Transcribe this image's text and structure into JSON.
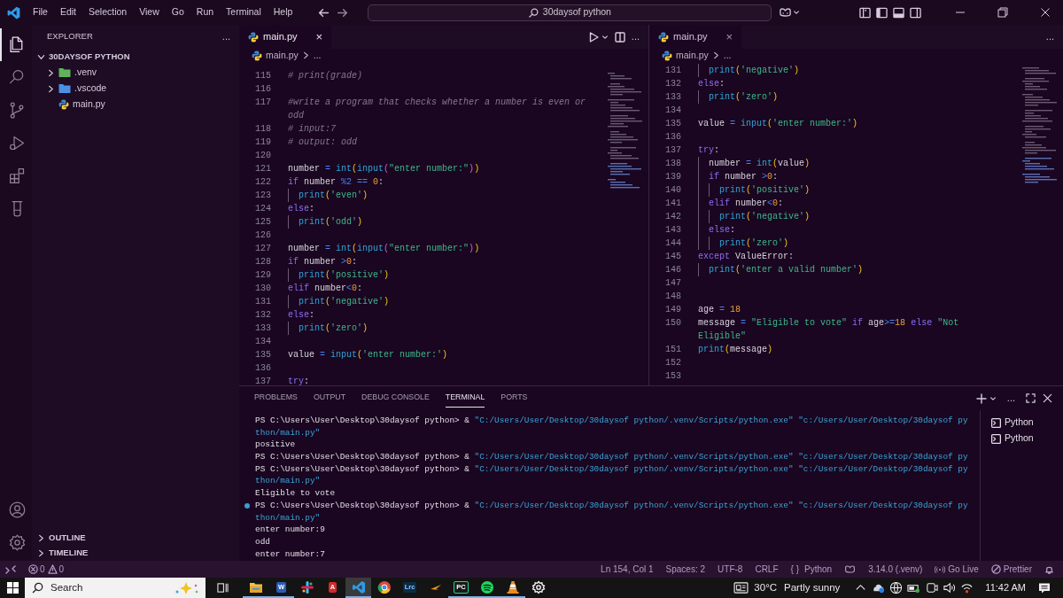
{
  "menu": [
    "File",
    "Edit",
    "Selection",
    "View",
    "Go",
    "Run",
    "Terminal",
    "Help"
  ],
  "command_center": {
    "text": "30daysof python"
  },
  "activity_bar": [
    {
      "selected": true
    },
    {
      "selected": false
    },
    {
      "selected": false
    },
    {
      "selected": false
    },
    {
      "selected": false
    },
    {
      "selected": false
    }
  ],
  "sidebar": {
    "title": "EXPLORER",
    "more": "...",
    "folder": {
      "name": "30DAYSOF PYTHON",
      "expanded": true,
      "children": [
        {
          "name": ".venv",
          "kind": "folder",
          "expanded": false,
          "color": "#5fb35a"
        },
        {
          "name": ".vscode",
          "kind": "folder",
          "expanded": false,
          "color": "#4c90e6"
        },
        {
          "name": "main.py",
          "kind": "file"
        }
      ]
    },
    "sections": [
      {
        "name": "OUTLINE",
        "expanded": false
      },
      {
        "name": "TIMELINE",
        "expanded": false
      }
    ]
  },
  "editors": [
    {
      "tab": {
        "label": "main.py",
        "close": "×",
        "focused": true
      },
      "run_actions": true,
      "more": "...",
      "breadcrumb": [
        "main.py",
        "..."
      ],
      "lines": [
        {
          "number": "115",
          "tokens": [
            {
              "kind": "comment",
              "text": "# print(grade)"
            }
          ]
        },
        {
          "number": "116"
        },
        {
          "number": "117",
          "tokens": [
            {
              "kind": "comment",
              "text": "#write a program that checks whether a number is even or"
            },
            {
              "kind": "break"
            },
            {
              "kind": "comment",
              "text": "odd"
            }
          ]
        },
        {
          "number": "118",
          "tokens": [
            {
              "kind": "comment",
              "text": "# input:7"
            }
          ]
        },
        {
          "number": "119",
          "tokens": [
            {
              "kind": "comment",
              "text": "# output: odd"
            }
          ]
        },
        {
          "number": "120"
        },
        {
          "number": "121",
          "tokens": [
            {
              "kind": "plain",
              "text": "number "
            },
            {
              "kind": "op",
              "text": "= "
            },
            {
              "kind": "fn",
              "text": "int"
            },
            {
              "kind": "paren",
              "text": "("
            },
            {
              "kind": "fn",
              "text": "input"
            },
            {
              "kind": "paren2",
              "text": "("
            },
            {
              "kind": "str",
              "text": "\"enter number:\""
            },
            {
              "kind": "paren2",
              "text": ")"
            },
            {
              "kind": "paren",
              "text": ")"
            }
          ]
        },
        {
          "number": "122",
          "tokens": [
            {
              "kind": "kw",
              "text": "if"
            },
            {
              "kind": "plain",
              "text": " number "
            },
            {
              "kind": "op",
              "text": "%2 == "
            },
            {
              "kind": "num",
              "text": "0"
            },
            {
              "kind": "plain",
              "text": ":"
            }
          ]
        },
        {
          "number": "123",
          "tokens": [
            {
              "kind": "indent"
            },
            {
              "kind": "fn",
              "text": "print"
            },
            {
              "kind": "paren",
              "text": "("
            },
            {
              "kind": "str",
              "text": "'even'"
            },
            {
              "kind": "paren",
              "text": ")"
            }
          ]
        },
        {
          "number": "124",
          "tokens": [
            {
              "kind": "kw",
              "text": "else"
            },
            {
              "kind": "plain",
              "text": ":"
            }
          ]
        },
        {
          "number": "125",
          "tokens": [
            {
              "kind": "indent"
            },
            {
              "kind": "fn",
              "text": "print"
            },
            {
              "kind": "paren",
              "text": "("
            },
            {
              "kind": "str",
              "text": "'odd'"
            },
            {
              "kind": "paren",
              "text": ")"
            }
          ]
        },
        {
          "number": "126"
        },
        {
          "number": "127",
          "tokens": [
            {
              "kind": "plain",
              "text": "number "
            },
            {
              "kind": "op",
              "text": "= "
            },
            {
              "kind": "fn",
              "text": "int"
            },
            {
              "kind": "paren",
              "text": "("
            },
            {
              "kind": "fn",
              "text": "input"
            },
            {
              "kind": "paren2",
              "text": "("
            },
            {
              "kind": "str",
              "text": "\"enter number:\""
            },
            {
              "kind": "paren2",
              "text": ")"
            },
            {
              "kind": "paren",
              "text": ")"
            }
          ]
        },
        {
          "number": "128",
          "tokens": [
            {
              "kind": "kw",
              "text": "if"
            },
            {
              "kind": "plain",
              "text": " number "
            },
            {
              "kind": "op",
              "text": ">"
            },
            {
              "kind": "num",
              "text": "0"
            },
            {
              "kind": "plain",
              "text": ":"
            }
          ]
        },
        {
          "number": "129",
          "tokens": [
            {
              "kind": "indent"
            },
            {
              "kind": "fn",
              "text": "print"
            },
            {
              "kind": "paren",
              "text": "("
            },
            {
              "kind": "str",
              "text": "'positive'"
            },
            {
              "kind": "paren",
              "text": ")"
            }
          ]
        },
        {
          "number": "130",
          "tokens": [
            {
              "kind": "kw",
              "text": "elif"
            },
            {
              "kind": "plain",
              "text": " number"
            },
            {
              "kind": "op",
              "text": "<"
            },
            {
              "kind": "num",
              "text": "0"
            },
            {
              "kind": "plain",
              "text": ":"
            }
          ]
        },
        {
          "number": "131",
          "tokens": [
            {
              "kind": "indent"
            },
            {
              "kind": "fn",
              "text": "print"
            },
            {
              "kind": "paren",
              "text": "("
            },
            {
              "kind": "str",
              "text": "'negative'"
            },
            {
              "kind": "paren",
              "text": ")"
            }
          ]
        },
        {
          "number": "132",
          "tokens": [
            {
              "kind": "kw",
              "text": "else"
            },
            {
              "kind": "plain",
              "text": ":"
            }
          ]
        },
        {
          "number": "133",
          "tokens": [
            {
              "kind": "indent"
            },
            {
              "kind": "fn",
              "text": "print"
            },
            {
              "kind": "paren",
              "text": "("
            },
            {
              "kind": "str",
              "text": "'zero'"
            },
            {
              "kind": "paren",
              "text": ")"
            }
          ]
        },
        {
          "number": "134"
        },
        {
          "number": "135",
          "tokens": [
            {
              "kind": "plain",
              "text": "value "
            },
            {
              "kind": "op",
              "text": "= "
            },
            {
              "kind": "fn",
              "text": "input"
            },
            {
              "kind": "paren",
              "text": "("
            },
            {
              "kind": "str",
              "text": "'enter number:'"
            },
            {
              "kind": "paren",
              "text": ")"
            }
          ]
        },
        {
          "number": "136"
        },
        {
          "number": "137",
          "tokens": [
            {
              "kind": "kw",
              "text": "try"
            },
            {
              "kind": "plain",
              "text": ":"
            }
          ]
        }
      ]
    },
    {
      "tab": {
        "label": "main.py",
        "close": "×",
        "focused": false
      },
      "run_actions": false,
      "more": "...",
      "breadcrumb": [
        "main.py",
        "..."
      ],
      "lines": [
        {
          "number": "131",
          "tokens": [
            {
              "kind": "indent"
            },
            {
              "kind": "fn",
              "text": "print"
            },
            {
              "kind": "paren",
              "text": "("
            },
            {
              "kind": "str",
              "text": "'negative'"
            },
            {
              "kind": "paren",
              "text": ")"
            }
          ]
        },
        {
          "number": "132",
          "tokens": [
            {
              "kind": "kw",
              "text": "else"
            },
            {
              "kind": "plain",
              "text": ":"
            }
          ]
        },
        {
          "number": "133",
          "tokens": [
            {
              "kind": "indent"
            },
            {
              "kind": "fn",
              "text": "print"
            },
            {
              "kind": "paren",
              "text": "("
            },
            {
              "kind": "str",
              "text": "'zero'"
            },
            {
              "kind": "paren",
              "text": ")"
            }
          ]
        },
        {
          "number": "134"
        },
        {
          "number": "135",
          "tokens": [
            {
              "kind": "plain",
              "text": "value "
            },
            {
              "kind": "op",
              "text": "= "
            },
            {
              "kind": "fn",
              "text": "input"
            },
            {
              "kind": "paren",
              "text": "("
            },
            {
              "kind": "str",
              "text": "'enter number:'"
            },
            {
              "kind": "paren",
              "text": ")"
            }
          ]
        },
        {
          "number": "136"
        },
        {
          "number": "137",
          "tokens": [
            {
              "kind": "kw",
              "text": "try"
            },
            {
              "kind": "plain",
              "text": ":"
            }
          ]
        },
        {
          "number": "138",
          "tokens": [
            {
              "kind": "indent"
            },
            {
              "kind": "plain",
              "text": "number "
            },
            {
              "kind": "op",
              "text": "= "
            },
            {
              "kind": "fn",
              "text": "int"
            },
            {
              "kind": "paren",
              "text": "("
            },
            {
              "kind": "plain",
              "text": "value"
            },
            {
              "kind": "paren",
              "text": ")"
            }
          ]
        },
        {
          "number": "139",
          "tokens": [
            {
              "kind": "indent"
            },
            {
              "kind": "kw",
              "text": "if"
            },
            {
              "kind": "plain",
              "text": " number "
            },
            {
              "kind": "op",
              "text": ">"
            },
            {
              "kind": "num",
              "text": "0"
            },
            {
              "kind": "plain",
              "text": ":"
            }
          ]
        },
        {
          "number": "140",
          "tokens": [
            {
              "kind": "indent"
            },
            {
              "kind": "indent"
            },
            {
              "kind": "fn",
              "text": "print"
            },
            {
              "kind": "paren",
              "text": "("
            },
            {
              "kind": "str",
              "text": "'positive'"
            },
            {
              "kind": "paren",
              "text": ")"
            }
          ]
        },
        {
          "number": "141",
          "tokens": [
            {
              "kind": "indent"
            },
            {
              "kind": "kw",
              "text": "elif"
            },
            {
              "kind": "plain",
              "text": " number"
            },
            {
              "kind": "op",
              "text": "<"
            },
            {
              "kind": "num",
              "text": "0"
            },
            {
              "kind": "plain",
              "text": ":"
            }
          ]
        },
        {
          "number": "142",
          "tokens": [
            {
              "kind": "indent"
            },
            {
              "kind": "indent"
            },
            {
              "kind": "fn",
              "text": "print"
            },
            {
              "kind": "paren",
              "text": "("
            },
            {
              "kind": "str",
              "text": "'negative'"
            },
            {
              "kind": "paren",
              "text": ")"
            }
          ]
        },
        {
          "number": "143",
          "tokens": [
            {
              "kind": "indent"
            },
            {
              "kind": "kw",
              "text": "else"
            },
            {
              "kind": "plain",
              "text": ":"
            }
          ]
        },
        {
          "number": "144",
          "tokens": [
            {
              "kind": "indent"
            },
            {
              "kind": "indent"
            },
            {
              "kind": "fn",
              "text": "print"
            },
            {
              "kind": "paren",
              "text": "("
            },
            {
              "kind": "str",
              "text": "'zero'"
            },
            {
              "kind": "paren",
              "text": ")"
            }
          ]
        },
        {
          "number": "145",
          "tokens": [
            {
              "kind": "kw",
              "text": "except"
            },
            {
              "kind": "plain",
              "text": " ValueError:"
            }
          ]
        },
        {
          "number": "146",
          "tokens": [
            {
              "kind": "indent"
            },
            {
              "kind": "fn",
              "text": "print"
            },
            {
              "kind": "paren",
              "text": "("
            },
            {
              "kind": "str",
              "text": "'enter a valid number'"
            },
            {
              "kind": "paren",
              "text": ")"
            }
          ]
        },
        {
          "number": "147"
        },
        {
          "number": "148"
        },
        {
          "number": "149",
          "tokens": [
            {
              "kind": "plain",
              "text": "age "
            },
            {
              "kind": "op",
              "text": "= "
            },
            {
              "kind": "num",
              "text": "18"
            }
          ]
        },
        {
          "number": "150",
          "tokens": [
            {
              "kind": "plain",
              "text": "message "
            },
            {
              "kind": "op",
              "text": "= "
            },
            {
              "kind": "str",
              "text": "\"Eligible to vote\" "
            },
            {
              "kind": "kw",
              "text": "if"
            },
            {
              "kind": "plain",
              "text": " age"
            },
            {
              "kind": "op",
              "text": ">="
            },
            {
              "kind": "num",
              "text": "18 "
            },
            {
              "kind": "kw",
              "text": "else"
            },
            {
              "kind": "str",
              "text": " \"Not"
            },
            {
              "kind": "break"
            },
            {
              "kind": "str",
              "text": "Eligible\""
            }
          ]
        },
        {
          "number": "151",
          "tokens": [
            {
              "kind": "fn",
              "text": "print"
            },
            {
              "kind": "paren",
              "text": "("
            },
            {
              "kind": "plain",
              "text": "message"
            },
            {
              "kind": "paren",
              "text": ")"
            }
          ]
        },
        {
          "number": "152"
        },
        {
          "number": "153"
        }
      ]
    }
  ],
  "panel": {
    "tabs": [
      {
        "label": "PROBLEMS",
        "selected": false
      },
      {
        "label": "OUTPUT",
        "selected": false
      },
      {
        "label": "DEBUG CONSOLE",
        "selected": false
      },
      {
        "label": "TERMINAL",
        "selected": true
      },
      {
        "label": "PORTS",
        "selected": false
      }
    ],
    "more": "...",
    "terminal": [
      {
        "command_mark": false,
        "segments": [
          {
            "kind": "text",
            "text": "PS C:\\Users\\User\\Desktop\\30daysof python> & "
          },
          {
            "kind": "path",
            "text": "\"C:/Users/User/Desktop/30daysof python/.venv/Scripts/python.exe\" \"c:/Users/User/Desktop/30daysof py"
          }
        ]
      },
      {
        "command_mark": false,
        "segments": [
          {
            "kind": "path",
            "text": "thon/main.py\""
          }
        ]
      },
      {
        "command_mark": false,
        "segments": [
          {
            "kind": "text",
            "text": "positive"
          }
        ]
      },
      {
        "command_mark": false,
        "segments": [
          {
            "kind": "text",
            "text": "PS C:\\Users\\User\\Desktop\\30daysof python> & "
          },
          {
            "kind": "path",
            "text": "\"C:/Users/User/Desktop/30daysof python/.venv/Scripts/python.exe\" \"c:/Users/User/Desktop/30daysof py"
          }
        ]
      },
      {
        "command_mark": false,
        "segments": [
          {
            "kind": "text",
            "text": "PS C:\\Users\\User\\Desktop\\30daysof python> & "
          },
          {
            "kind": "path",
            "text": "\"C:/Users/User/Desktop/30daysof python/.venv/Scripts/python.exe\" \"c:/Users/User/Desktop/30daysof py"
          }
        ]
      },
      {
        "command_mark": false,
        "segments": [
          {
            "kind": "path",
            "text": "thon/main.py\""
          }
        ]
      },
      {
        "command_mark": false,
        "segments": [
          {
            "kind": "text",
            "text": "Eligible to vote"
          }
        ]
      },
      {
        "command_mark": true,
        "segments": [
          {
            "kind": "text",
            "text": "PS C:\\Users\\User\\Desktop\\30daysof python> & "
          },
          {
            "kind": "path",
            "text": "\"C:/Users/User/Desktop/30daysof python/.venv/Scripts/python.exe\" \"c:/Users/User/Desktop/30daysof py"
          }
        ]
      },
      {
        "command_mark": false,
        "segments": [
          {
            "kind": "path",
            "text": "thon/main.py\""
          }
        ]
      },
      {
        "command_mark": false,
        "segments": [
          {
            "kind": "text",
            "text": "enter number:9"
          }
        ]
      },
      {
        "command_mark": false,
        "segments": [
          {
            "kind": "text",
            "text": "odd"
          }
        ]
      },
      {
        "command_mark": false,
        "segments": [
          {
            "kind": "text",
            "text": "enter number:7"
          }
        ]
      }
    ],
    "sessions": [
      {
        "label": "Python"
      },
      {
        "label": "Python"
      }
    ]
  },
  "status_bar": {
    "errors": "0",
    "warnings": "0",
    "items": [
      {
        "kind": "plain",
        "text": "Ln 154, Col 1"
      },
      {
        "kind": "plain",
        "text": "Spaces: 2"
      },
      {
        "kind": "plain",
        "text": "UTF-8"
      },
      {
        "kind": "plain",
        "text": "CRLF"
      },
      {
        "kind": "braces",
        "text": "{ }"
      },
      {
        "kind": "plain",
        "text": "Python"
      },
      {
        "kind": "goggles"
      },
      {
        "kind": "plain",
        "text": "3.14.0 (.venv)"
      },
      {
        "kind": "live",
        "text": "Go Live"
      },
      {
        "kind": "prettier",
        "text": "Prettier"
      },
      {
        "kind": "bell"
      }
    ]
  },
  "taskbar": {
    "search": "Search",
    "apps": [
      {
        "kind": "folder",
        "running": true,
        "active": false
      },
      {
        "kind": "word",
        "label": "W",
        "running": true,
        "active": false
      },
      {
        "kind": "slack",
        "running": false,
        "active": false
      },
      {
        "kind": "acrobat",
        "label": "A",
        "running": false,
        "active": false
      },
      {
        "kind": "vscode",
        "running": true,
        "active": true
      },
      {
        "kind": "chrome",
        "running": false,
        "active": false
      },
      {
        "kind": "lightroom",
        "label": "Lrc",
        "running": false,
        "active": false
      },
      {
        "kind": "arrow",
        "running": false,
        "active": false
      },
      {
        "kind": "pycharm",
        "label": "PC",
        "running": true,
        "active": false
      },
      {
        "kind": "spotify",
        "running": true,
        "active": false
      },
      {
        "kind": "cone",
        "running": true,
        "active": false
      },
      {
        "kind": "gear",
        "running": false,
        "active": false
      }
    ],
    "weather": {
      "temperature": "30°C",
      "text": "Partly sunny"
    },
    "clock": "11:42 AM"
  }
}
